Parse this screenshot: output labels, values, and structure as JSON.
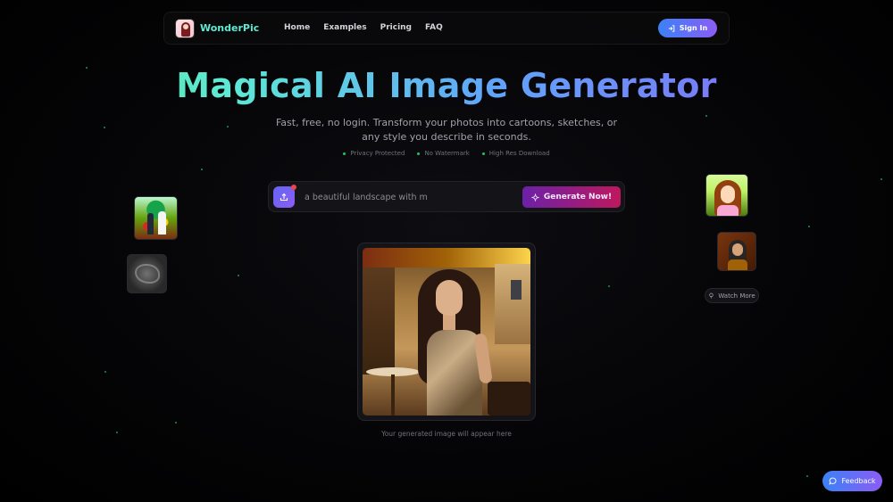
{
  "nav": {
    "brand": "WonderPic",
    "links": [
      "Home",
      "Examples",
      "Pricing",
      "FAQ"
    ],
    "signin_label": "Sign In"
  },
  "hero": {
    "title": "Magical AI Image Generator",
    "subtitle": "Fast, free, no login. Transform your photos into cartoons, sketches, or any style you describe in seconds.",
    "badges": [
      "Privacy Protected",
      "No Watermark",
      "High Res Download"
    ]
  },
  "prompt": {
    "value": "a beautiful landscape with m",
    "generate_label": "Generate Now!"
  },
  "watch_more_label": "Watch More",
  "result_caption": "Your generated image will appear here",
  "feedback_label": "Feedback",
  "colors": {
    "accent_gradient_start": "#3b82f6",
    "accent_gradient_end": "#8b5cf6",
    "generate_start": "#6b21a8",
    "generate_end": "#be185d",
    "badge_dot": "#22c55e"
  }
}
